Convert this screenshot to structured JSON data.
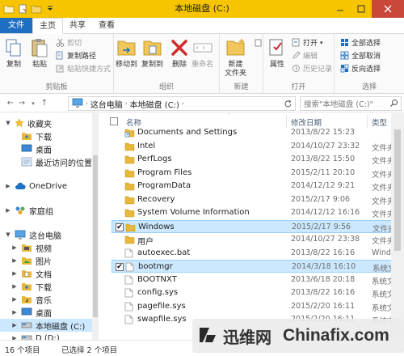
{
  "window": {
    "title": "本地磁盘 (C:)"
  },
  "ribbon_tabs": [
    {
      "label": "文件"
    },
    {
      "label": "主页"
    },
    {
      "label": "共享"
    },
    {
      "label": "查看"
    }
  ],
  "ribbon": {
    "clipboard": {
      "copy": "复制",
      "paste": "粘贴",
      "cut": "剪切",
      "copy_path": "复制路径",
      "paste_shortcut": "粘贴快捷方式",
      "label": "剪贴板"
    },
    "organize": {
      "move_to": "移动到",
      "copy_to": "复制到",
      "delete": "删除",
      "rename": "重命名",
      "label": "组织"
    },
    "new": {
      "new_folder_line1": "新建",
      "new_folder_line2": "文件夹",
      "label": "新建"
    },
    "open": {
      "properties": "属性",
      "open": "打开",
      "edit": "编辑",
      "history": "历史记录",
      "label": "打开"
    },
    "select": {
      "select_all": "全部选择",
      "select_none": "全部取消",
      "invert": "反向选择",
      "label": "选择"
    }
  },
  "address": {
    "path": [
      "这台电脑",
      "本地磁盘 (C:)"
    ],
    "search_placeholder": "搜索\"本地磁盘 (C:)\""
  },
  "nav_pane": [
    {
      "label": "收藏夹",
      "icon": "star-icon",
      "level": 0,
      "expander": "▼"
    },
    {
      "label": "下载",
      "icon": "download-folder-icon",
      "level": 1
    },
    {
      "label": "桌面",
      "icon": "desktop-icon",
      "level": 1
    },
    {
      "label": "最近访问的位置",
      "icon": "recent-icon",
      "level": 1
    },
    {
      "label": "OneDrive",
      "icon": "cloud-icon",
      "level": 0,
      "expander": "▶"
    },
    {
      "label": "家庭组",
      "icon": "homegroup-icon",
      "level": 0,
      "expander": "▶"
    },
    {
      "label": "这台电脑",
      "icon": "computer-icon",
      "level": 0,
      "expander": "▼"
    },
    {
      "label": "视频",
      "icon": "video-folder-icon",
      "level": 1,
      "expander": "▶"
    },
    {
      "label": "图片",
      "icon": "picture-folder-icon",
      "level": 1,
      "expander": "▶"
    },
    {
      "label": "文档",
      "icon": "document-folder-icon",
      "level": 1,
      "expander": "▶"
    },
    {
      "label": "下载",
      "icon": "download-folder-icon",
      "level": 1,
      "expander": "▶"
    },
    {
      "label": "音乐",
      "icon": "music-folder-icon",
      "level": 1,
      "expander": "▶"
    },
    {
      "label": "桌面",
      "icon": "desktop-icon",
      "level": 1,
      "expander": "▶"
    },
    {
      "label": "本地磁盘 (C:)",
      "icon": "drive-icon",
      "level": 1,
      "expander": "▶",
      "selected": true
    },
    {
      "label": "D (D:)",
      "icon": "drive-icon",
      "level": 1,
      "expander": "▶"
    }
  ],
  "columns": {
    "name": "名称",
    "date": "修改日期",
    "type": "类型"
  },
  "files": [
    {
      "name": "Documents and Settings",
      "date": "2013/8/22 15:23",
      "type": "",
      "kind": "shortcut-folder"
    },
    {
      "name": "Intel",
      "date": "2014/10/27 23:32",
      "type": "文件夹",
      "kind": "folder"
    },
    {
      "name": "PerfLogs",
      "date": "2013/8/22 15:50",
      "type": "文件夹",
      "kind": "folder"
    },
    {
      "name": "Program Files",
      "date": "2015/2/11 20:10",
      "type": "文件夹",
      "kind": "folder"
    },
    {
      "name": "ProgramData",
      "date": "2014/12/12 9:21",
      "type": "文件夹",
      "kind": "folder"
    },
    {
      "name": "Recovery",
      "date": "2015/2/17 9:06",
      "type": "文件夹",
      "kind": "folder"
    },
    {
      "name": "System Volume Information",
      "date": "2014/12/12 16:16",
      "type": "文件夹",
      "kind": "folder"
    },
    {
      "name": "Windows",
      "date": "2015/2/17 9:56",
      "type": "文件夹",
      "kind": "folder",
      "selected": true
    },
    {
      "name": "用户",
      "date": "2014/10/27 23:38",
      "type": "文件夹",
      "kind": "folder"
    },
    {
      "name": "autoexec.bat",
      "date": "2013/8/22 16:16",
      "type": "Windows",
      "kind": "file"
    },
    {
      "name": "bootmgr",
      "date": "2014/3/18 16:10",
      "type": "系统文件",
      "kind": "file",
      "selected": true
    },
    {
      "name": "BOOTNXT",
      "date": "2013/6/18 20:18",
      "type": "系统文件",
      "kind": "file"
    },
    {
      "name": "config.sys",
      "date": "2013/8/22 16:16",
      "type": "系统文件",
      "kind": "file"
    },
    {
      "name": "pagefile.sys",
      "date": "2015/2/20 16:11",
      "type": "系统文件",
      "kind": "file"
    },
    {
      "name": "swapfile.sys",
      "date": "2015/2/20 16:11",
      "type": "系统文件",
      "kind": "file"
    }
  ],
  "status": {
    "count": "16 个项目",
    "selected": "已选择 2 个项目"
  },
  "watermark": {
    "text1": "迅维网",
    "text2": "Chinafix.com"
  },
  "colors": {
    "titlebar": "#f6c500",
    "file_tab": "#1e6fc1",
    "selection": "#cce8ff",
    "folder": "#e8b83a",
    "close": "#c9483a"
  }
}
